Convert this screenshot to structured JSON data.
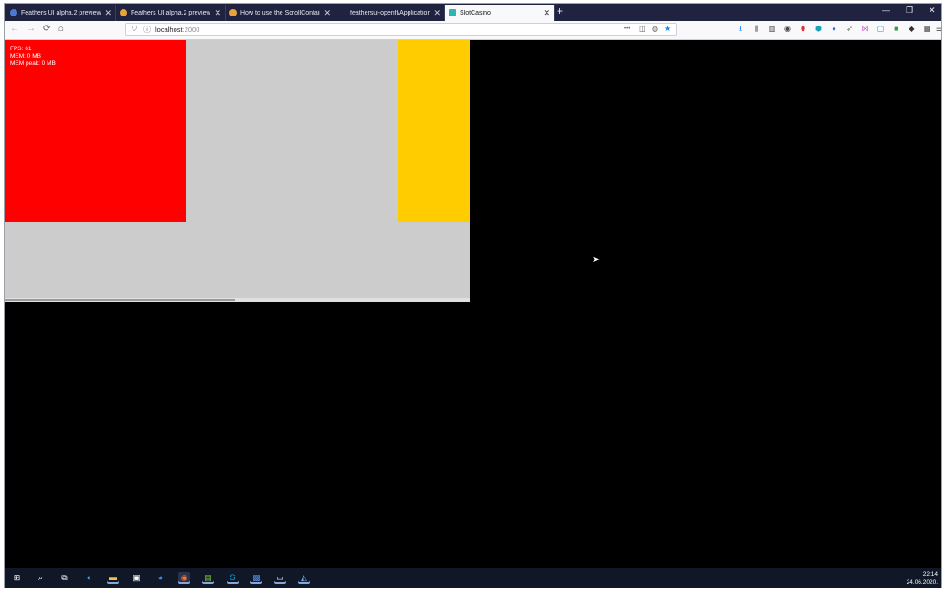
{
  "browser": {
    "tabs": [
      {
        "title": "Feathers UI alpha.2 preview bu",
        "fav_color": "#4a7bd4",
        "active": false
      },
      {
        "title": "Feathers UI alpha.2 preview bu",
        "fav_color": "#e8a33a",
        "active": false
      },
      {
        "title": "How to use the ScrollContaine",
        "fav_color": "#e8a33a",
        "active": false
      },
      {
        "title": "feathersui-openfl/Application",
        "fav_color": "#1f2340",
        "active": false
      },
      {
        "title": "SlotCasino",
        "fav_color": "#2bb5b5",
        "active": true
      }
    ],
    "new_tab": "+",
    "window_controls": {
      "minimize": "—",
      "restore": "❐",
      "close": "✕"
    },
    "nav": {
      "back": "←",
      "forward": "→",
      "reload": "⟳",
      "home": "⌂"
    },
    "url": {
      "host": "localhost",
      "port": ":2000"
    },
    "url_actions": {
      "more": "•••",
      "pocket": "◫",
      "reader": "◍",
      "bookmark": "★"
    }
  },
  "app": {
    "stats": {
      "fps": "FPS: 61",
      "mem": "MEM: 0 MB",
      "mem_peak": "MEM peak: 0 MB"
    },
    "colors": {
      "red": "#ff0000",
      "yellow": "#ffcc00",
      "gray": "#cccccc",
      "background": "#000000"
    }
  },
  "taskbar": {
    "clock": {
      "time": "22:14",
      "date": "24.06.2020."
    }
  }
}
